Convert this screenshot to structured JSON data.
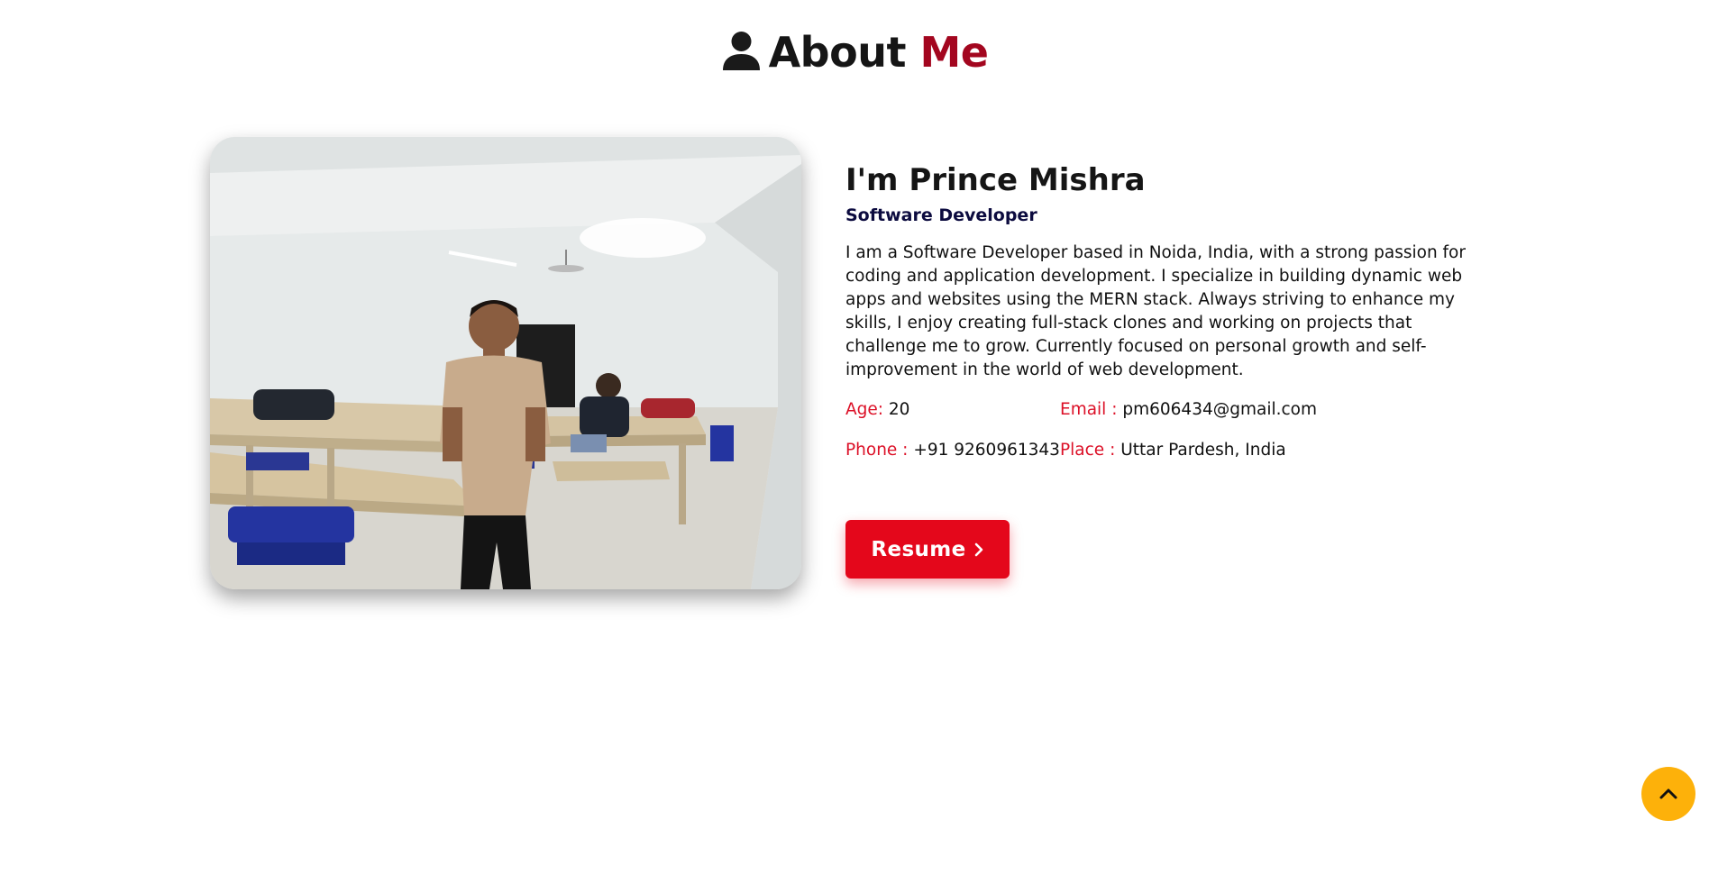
{
  "header": {
    "title_part1": "About",
    "title_part2": "Me",
    "icon": "user-icon"
  },
  "profile": {
    "photo_alt": "Prince Mishra standing in a classroom",
    "name": "I'm Prince Mishra",
    "role": "Software Developer",
    "bio": "I am a Software Developer based in Noida, India, with a strong passion for coding and application development. I specialize in building dynamic web apps and websites using the MERN stack. Always striving to enhance my skills, I enjoy creating full-stack clones and working on projects that challenge me to grow. Currently focused on personal growth and self-improvement in the world of web development.",
    "details": {
      "age_label": "Age:",
      "age_value": "20",
      "email_label": "Email :",
      "email_value": "pm606434@gmail.com",
      "phone_label": "Phone :",
      "phone_value": "+91 9260961343",
      "place_label": "Place :",
      "place_value": "Uttar Pardesh, India"
    }
  },
  "actions": {
    "resume_label": "Resume",
    "resume_icon": "chevron-right-icon",
    "scroll_top_icon": "chevron-up-icon"
  },
  "colors": {
    "accent_red": "#e4071b",
    "title_red": "#a3061f",
    "label_red": "#dc1027",
    "role_navy": "#0c0b3f",
    "scroll_button": "#fdb10a"
  }
}
